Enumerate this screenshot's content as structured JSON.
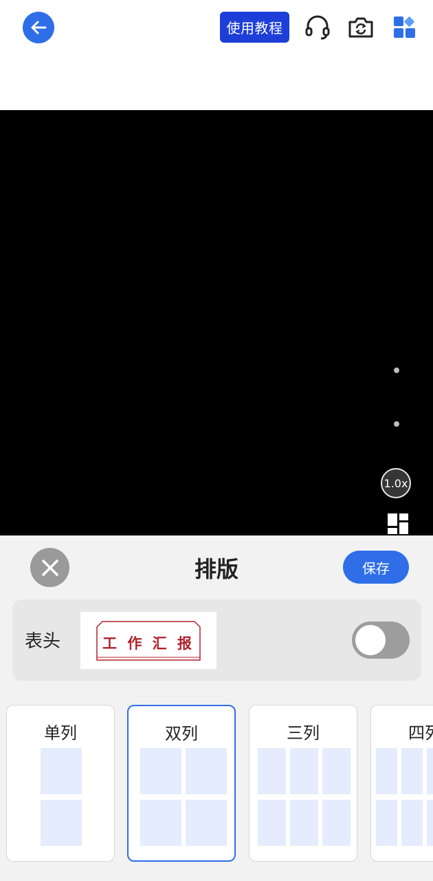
{
  "toolbar": {
    "tutorial_label": "使用教程",
    "icons": [
      "back-arrow-icon",
      "headset-icon",
      "camera-switch-icon",
      "apps-grid-icon"
    ]
  },
  "camera": {
    "zoom_label": "1.0x"
  },
  "panel": {
    "title": "排版",
    "save_label": "保存",
    "header_label": "表头",
    "header_preview_text": "工 作 汇 报",
    "header_enabled": false
  },
  "layout_options": [
    {
      "label": "单列",
      "columns": 1,
      "selected": false
    },
    {
      "label": "双列",
      "columns": 2,
      "selected": true
    },
    {
      "label": "三列",
      "columns": 3,
      "selected": false
    },
    {
      "label": "四列",
      "columns": 4,
      "selected": false
    }
  ],
  "colors": {
    "accent": "#2f6ee7",
    "tutorial_button": "#1d3fd8",
    "preview_red": "#b3202c",
    "grid_cell": "#e4ecfd"
  }
}
